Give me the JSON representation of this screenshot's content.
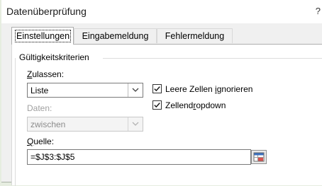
{
  "dialog": {
    "title": "Datenüberprüfung",
    "help": "?"
  },
  "tabs": [
    {
      "label": "Einstellungen"
    },
    {
      "label": "Eingabemeldung"
    },
    {
      "label": "Fehlermeldung"
    }
  ],
  "criteria": {
    "group_title": "Gültigkeitskriterien",
    "allow_label_u": "Z",
    "allow_label_rest": "ulassen:",
    "allow_value": "Liste",
    "data_label": "Daten:",
    "data_value": "zwischen",
    "source_label_u": "Q",
    "source_label_rest": "uelle:",
    "source_value": "=$J$3:$J$5"
  },
  "options": {
    "ignore_blank": {
      "pre": "Leere Zellen ",
      "u": "i",
      "post": "gnorieren",
      "checked": true
    },
    "in_cell_dropdown": {
      "pre": "Zellend",
      "u": "r",
      "post": "opdown",
      "checked": true
    }
  },
  "icons": {
    "dropdown": "chevron-down-icon",
    "checkmark": "checkmark-icon",
    "range_select": "collapse-dialog-icon"
  },
  "colors": {
    "accent": "#217346",
    "disabled_text": "#a0a0a0"
  }
}
